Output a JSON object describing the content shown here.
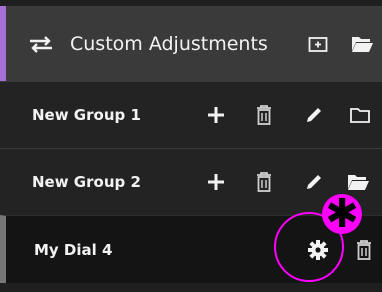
{
  "header": {
    "title": "Custom Adjustments",
    "accent_color": "#a870d6",
    "icons": [
      "swap-arrows-icon",
      "add-folder-icon",
      "open-folder-icon"
    ]
  },
  "groups": [
    {
      "label": "New Group 1",
      "icons": [
        "plus-icon",
        "trash-icon",
        "pencil-icon",
        "folder-icon"
      ]
    },
    {
      "label": "New Group 2",
      "icons": [
        "plus-icon",
        "trash-icon",
        "pencil-icon",
        "open-folder-icon"
      ]
    }
  ],
  "dial": {
    "label": "My Dial 4",
    "icons": [
      "gear-icon",
      "trash-icon"
    ],
    "highlight_color": "#ff00ff",
    "badge_symbol": "✱"
  }
}
